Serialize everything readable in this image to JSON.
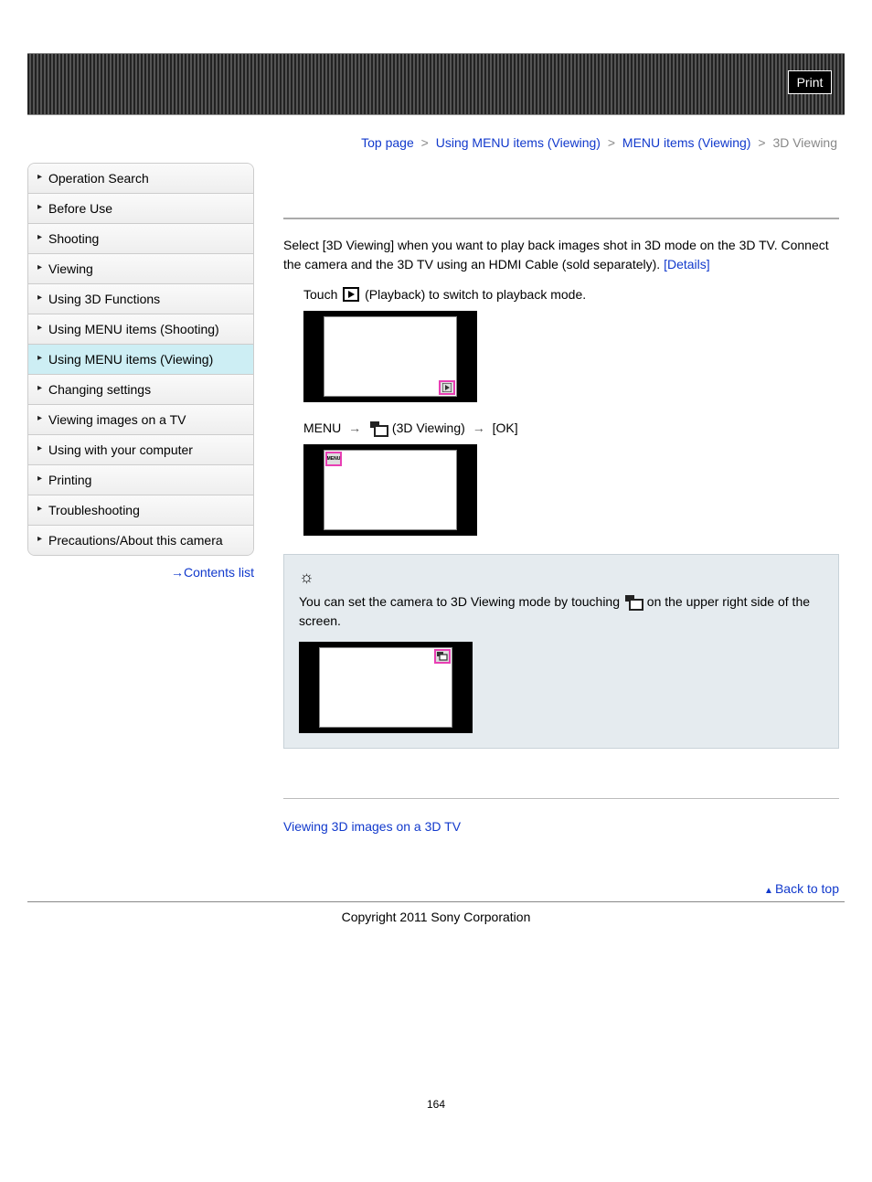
{
  "header": {
    "print": "Print"
  },
  "breadcrumb": {
    "items": [
      "Top page",
      "Using MENU items (Viewing)",
      "MENU items (Viewing)",
      "3D Viewing"
    ],
    "sep": ">"
  },
  "sidebar": {
    "items": [
      {
        "label": "Operation Search"
      },
      {
        "label": "Before Use"
      },
      {
        "label": "Shooting"
      },
      {
        "label": "Viewing"
      },
      {
        "label": "Using 3D Functions"
      },
      {
        "label": "Using MENU items (Shooting)"
      },
      {
        "label": "Using MENU items (Viewing)",
        "active": true
      },
      {
        "label": "Changing settings"
      },
      {
        "label": "Viewing images on a TV"
      },
      {
        "label": "Using with your computer"
      },
      {
        "label": "Printing"
      },
      {
        "label": "Troubleshooting"
      },
      {
        "label": "Precautions/About this camera"
      }
    ],
    "contents": "Contents list"
  },
  "main": {
    "intro_a": "Select [3D Viewing] when you want to play back images shot in 3D mode on the 3D TV. Connect the camera and the 3D TV using an HDMI Cable (sold separately). ",
    "details": "[Details]",
    "step1_a": "Touch ",
    "step1_b": " (Playback) to switch to playback mode.",
    "menu_label": "MENU",
    "threed_label": " (3D Viewing)",
    "ok_label": "[OK]",
    "hl_menu": "MENU",
    "tip_a": "You can set the camera to 3D Viewing mode by touching ",
    "tip_b": " on the upper right side of the screen.",
    "related": "Viewing 3D images on a 3D TV",
    "backtop": "Back to top"
  },
  "footer": {
    "copyright": "Copyright 2011 Sony Corporation",
    "pagenum": "164"
  }
}
